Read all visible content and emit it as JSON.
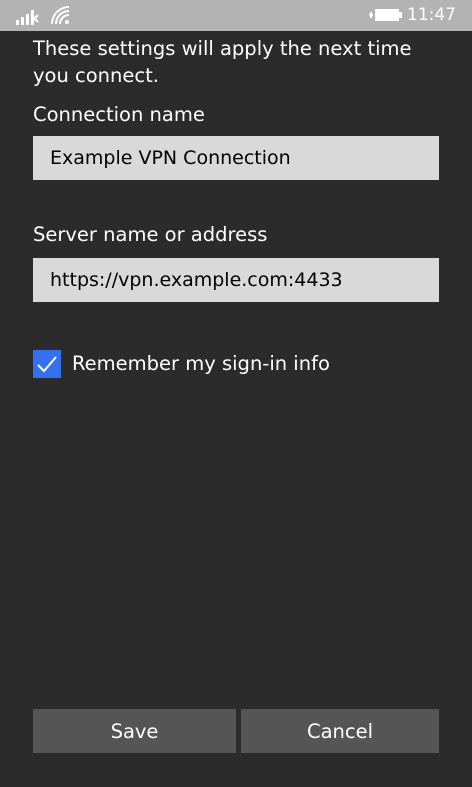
{
  "status_bar": {
    "time": "11:47",
    "icons": [
      "cellular-signal-icon",
      "wifi-icon",
      "battery-charging-icon"
    ]
  },
  "form": {
    "intro_text": "These settings will apply the next time you connect.",
    "connection_name_label": "Connection name",
    "connection_name_value": "Example VPN Connection",
    "server_label": "Server name or address",
    "server_value": "https://vpn.example.com:4433",
    "remember_label": "Remember my sign-in info",
    "remember_checked": true
  },
  "buttons": {
    "save_label": "Save",
    "cancel_label": "Cancel"
  },
  "colors": {
    "background": "#2b2b2b",
    "status_bar": "#b3b3b3",
    "accent": "#3470ef",
    "textbox": "#d9d9d9",
    "button": "#555555"
  }
}
